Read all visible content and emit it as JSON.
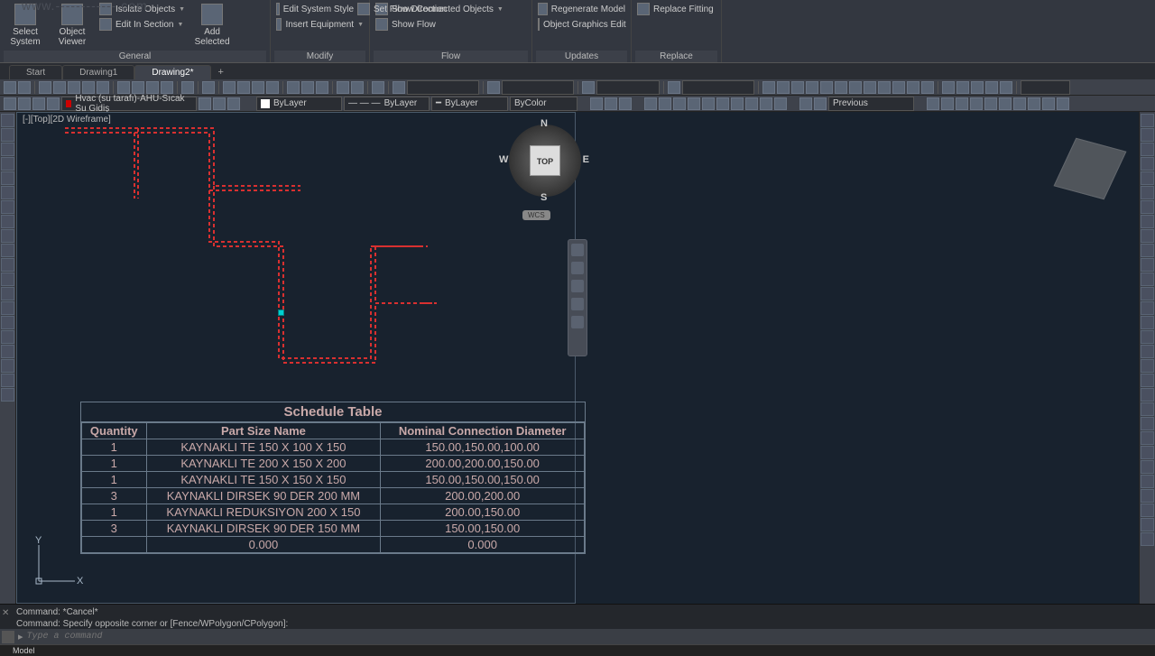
{
  "watermark": "www.------------.com",
  "ribbon": {
    "panels": [
      {
        "label": "General",
        "big": [
          {
            "l": "Select\nSystem"
          },
          {
            "l": "Object\nViewer"
          }
        ],
        "items": [
          [
            "Isolate Objects",
            true
          ],
          [
            "Edit In Section",
            true
          ]
        ],
        "big2": [
          {
            "l": "Add\nSelected"
          }
        ]
      },
      {
        "label": "Modify",
        "items": [
          [
            "Edit System Style",
            true
          ],
          [
            "Insert Equipment",
            true
          ]
        ]
      },
      {
        "label": "Flow",
        "items": [
          [
            "Show Connected Objects",
            true
          ],
          [
            "Show Flow",
            false
          ],
          [
            "Set Flow Direction",
            false
          ]
        ]
      },
      {
        "label": "Updates",
        "items": [
          [
            "Regenerate Model",
            false
          ],
          [
            "Object Graphics Edit",
            false
          ]
        ]
      },
      {
        "label": "Replace",
        "items": [
          [
            "Replace Fitting",
            false
          ]
        ]
      }
    ]
  },
  "tabs": {
    "items": [
      "Start",
      "Drawing1",
      "Drawing2*"
    ],
    "active": 2
  },
  "layer_drop": "Hvac (su tarafı)-AHU-Sıcak Su Gidiş",
  "props": {
    "layer": "ByLayer",
    "ltype": "ByLayer",
    "lweight": "ByLayer",
    "color": "ByColor",
    "prev": "Previous"
  },
  "viewport_label": "[-][Top][2D Wireframe]",
  "compass": {
    "top": "TOP",
    "n": "N",
    "s": "S",
    "e": "E",
    "w": "W"
  },
  "wcs": "WCS",
  "ucs": {
    "x": "X",
    "y": "Y"
  },
  "schedule": {
    "title": "Schedule Table",
    "headers": [
      "Quantity",
      "Part Size Name",
      "Nominal Connection Diameter"
    ],
    "rows": [
      [
        "1",
        "KAYNAKLI TE 150 X 100 X 150",
        "150.00,150.00,100.00"
      ],
      [
        "1",
        "KAYNAKLI TE 200 X 150 X 200",
        "200.00,200.00,150.00"
      ],
      [
        "1",
        "KAYNAKLI TE 150 X 150 X 150",
        "150.00,150.00,150.00"
      ],
      [
        "3",
        "KAYNAKLI DIRSEK 90 DER 200 MM",
        "200.00,200.00"
      ],
      [
        "1",
        "KAYNAKLI REDUKSIYON 200 X 150",
        "200.00,150.00"
      ],
      [
        "3",
        "KAYNAKLI DIRSEK 90 DER 150 MM",
        "150.00,150.00"
      ],
      [
        "",
        "0.000",
        "0.000"
      ]
    ]
  },
  "cmd": {
    "line1": "Command: *Cancel*",
    "line2": "Command: Specify opposite corner or [Fence/WPolygon/CPolygon]:",
    "placeholder": "Type a command"
  },
  "status_tab": "Model"
}
